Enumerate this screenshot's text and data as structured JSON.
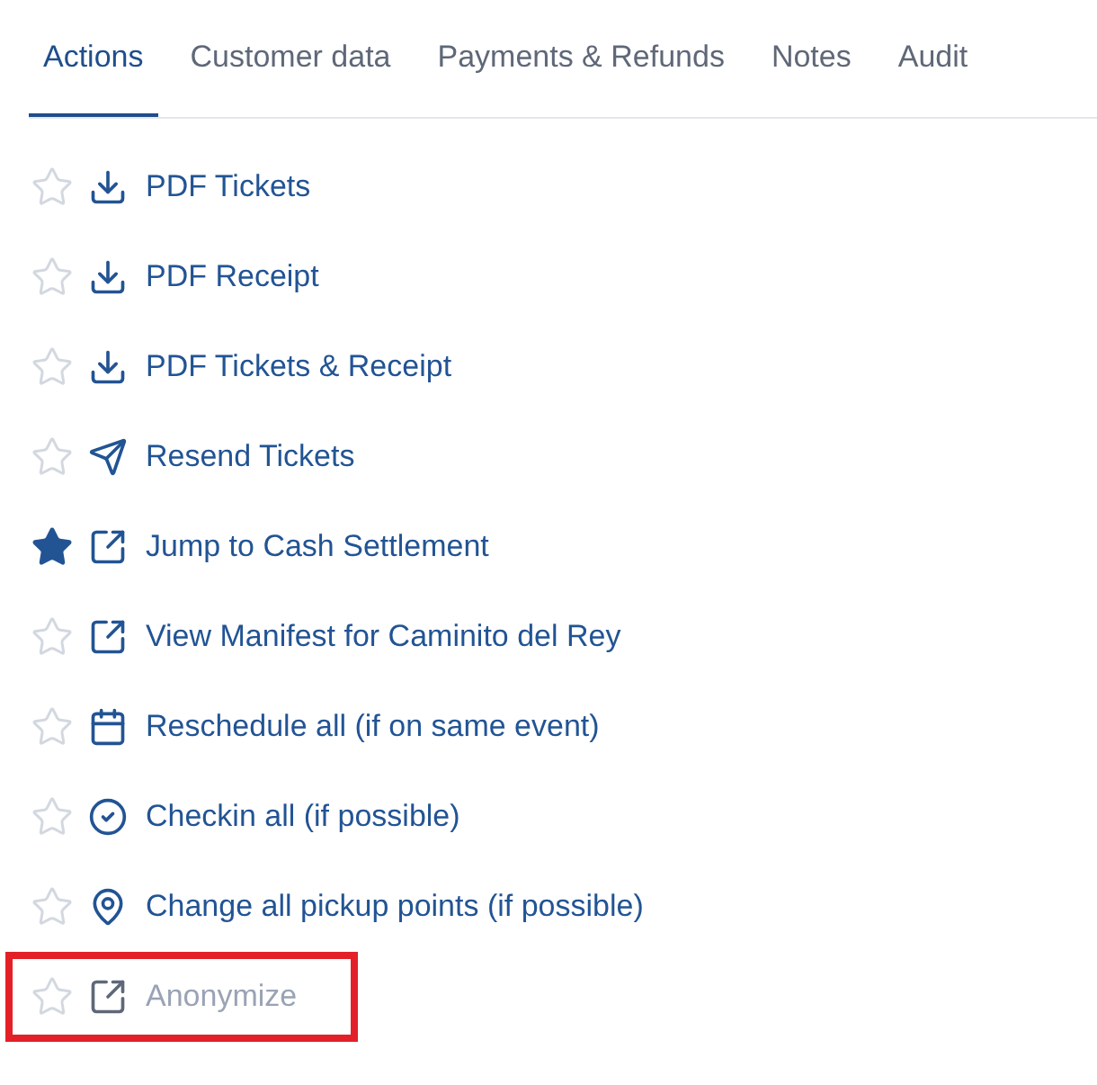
{
  "tabs": [
    {
      "label": "Actions",
      "selected": true
    },
    {
      "label": "Customer data",
      "selected": false
    },
    {
      "label": "Payments & Refunds",
      "selected": false
    },
    {
      "label": "Notes",
      "selected": false
    },
    {
      "label": "Audit",
      "selected": false
    }
  ],
  "actions": [
    {
      "label": "PDF Tickets",
      "kind": "download",
      "starred": false,
      "disabled": false,
      "highlighted": false
    },
    {
      "label": "PDF Receipt",
      "kind": "download",
      "starred": false,
      "disabled": false,
      "highlighted": false
    },
    {
      "label": "PDF Tickets & Receipt",
      "kind": "download",
      "starred": false,
      "disabled": false,
      "highlighted": false
    },
    {
      "label": "Resend Tickets",
      "kind": "send",
      "starred": false,
      "disabled": false,
      "highlighted": false
    },
    {
      "label": "Jump to Cash Settlement",
      "kind": "external",
      "starred": true,
      "disabled": false,
      "highlighted": false
    },
    {
      "label": "View Manifest for Caminito del Rey",
      "kind": "external",
      "starred": false,
      "disabled": false,
      "highlighted": false
    },
    {
      "label": "Reschedule all (if on same event)",
      "kind": "calendar",
      "starred": false,
      "disabled": false,
      "highlighted": false
    },
    {
      "label": "Checkin all (if possible)",
      "kind": "check",
      "starred": false,
      "disabled": false,
      "highlighted": false
    },
    {
      "label": "Change all pickup points (if possible)",
      "kind": "pin",
      "starred": false,
      "disabled": false,
      "highlighted": false
    },
    {
      "label": "Anonymize",
      "kind": "external",
      "starred": false,
      "disabled": true,
      "highlighted": true
    }
  ]
}
